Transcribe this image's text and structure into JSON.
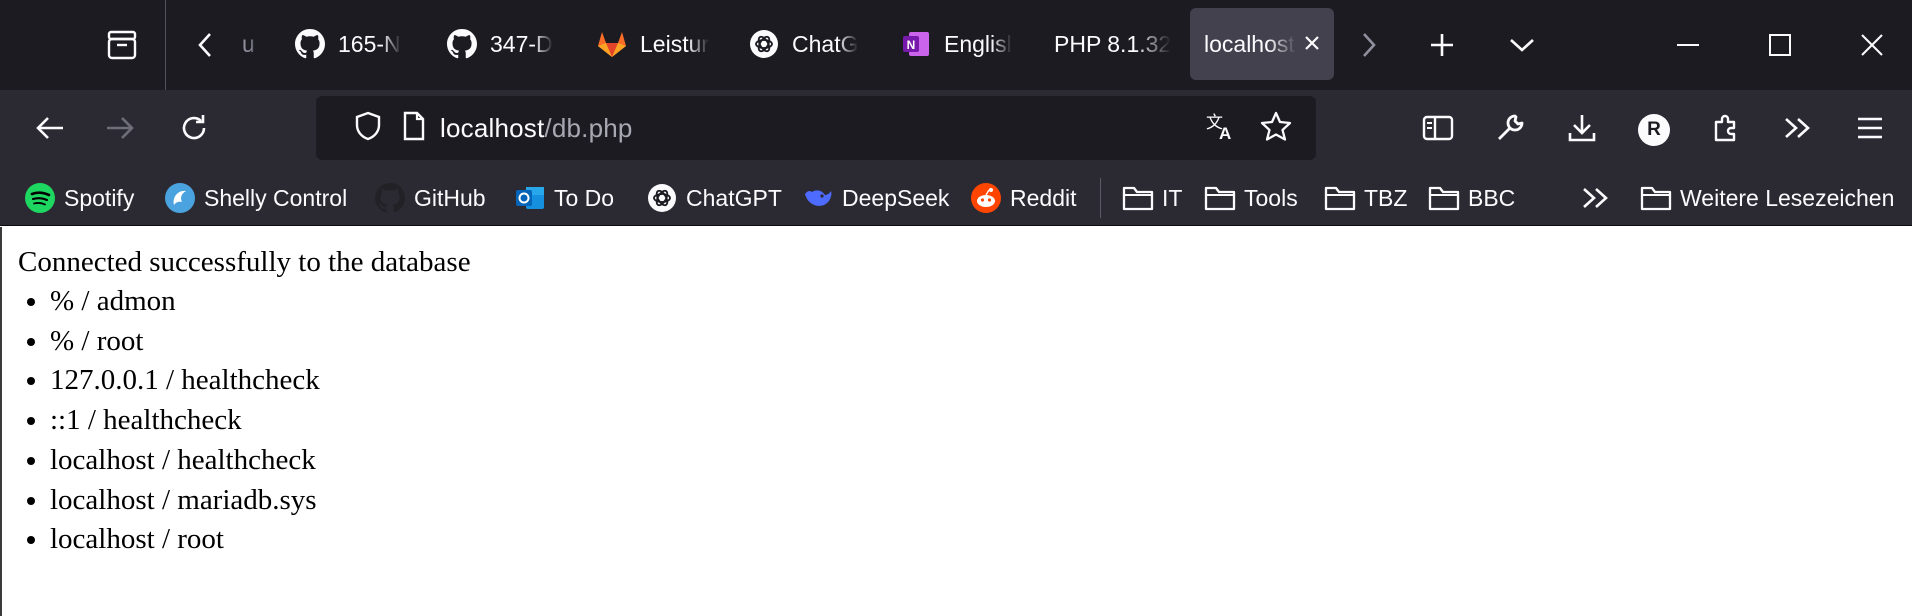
{
  "tabs": [
    {
      "title": "u",
      "icon": "hidden-tab-icon"
    },
    {
      "title": "165-N",
      "icon": "github-icon"
    },
    {
      "title": "347-D",
      "icon": "github-icon"
    },
    {
      "title": "Leistur",
      "icon": "gitlab-icon"
    },
    {
      "title": "ChatG",
      "icon": "chatgpt-icon"
    },
    {
      "title": "Englisl",
      "icon": "onenote-icon"
    },
    {
      "title": "PHP 8.1.32",
      "icon": ""
    },
    {
      "title": "localhost",
      "icon": "",
      "active": true
    }
  ],
  "urlbar": {
    "host": "localhost",
    "path": "/db.php"
  },
  "profile": {
    "initial": "R"
  },
  "bookmarks": [
    {
      "label": "Spotify",
      "icon": "spotify-icon"
    },
    {
      "label": "Shelly Control",
      "icon": "shelly-icon"
    },
    {
      "label": "GitHub",
      "icon": "github-icon"
    },
    {
      "label": "To Do",
      "icon": "outlook-icon"
    },
    {
      "label": "ChatGPT",
      "icon": "chatgpt-icon"
    },
    {
      "label": "DeepSeek",
      "icon": "deepseek-icon"
    },
    {
      "label": "Reddit",
      "icon": "reddit-icon"
    }
  ],
  "folders": [
    {
      "label": "IT"
    },
    {
      "label": "Tools"
    },
    {
      "label": "TBZ"
    },
    {
      "label": "BBC"
    }
  ],
  "other_bookmarks": "Weitere Lesezeichen",
  "page": {
    "message": "Connected successfully to the database",
    "users": [
      "% / admon",
      "% / root",
      "127.0.0.1 / healthcheck",
      "::1 / healthcheck",
      "localhost / healthcheck",
      "localhost / mariadb.sys",
      "localhost / root"
    ]
  },
  "colors": {
    "tabstrip_bg": "#1c1b22",
    "toolbar_bg": "#2b2a33",
    "active_tab_bg": "#42414d",
    "page_bg": "#ffffff"
  }
}
